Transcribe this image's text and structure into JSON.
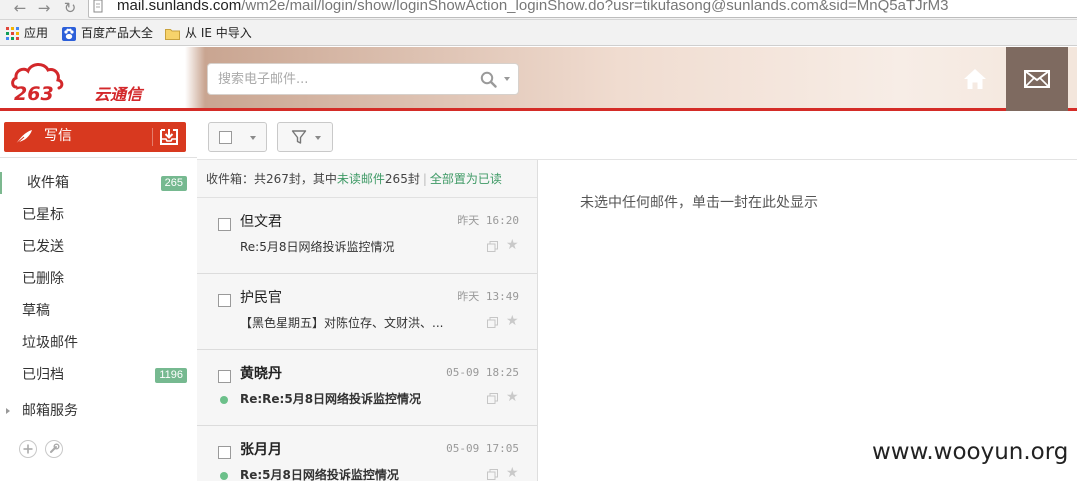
{
  "browser": {
    "url_host": "mail.sunlands.com",
    "url_rest": "/wm2e/mail/login/show/loginShowAction_loginShow.do?usr=tikufasong@sunlands.com&sid=MnQ5aTJrM3",
    "bookmarks": [
      "应用",
      "百度产品大全",
      "从 IE 中导入"
    ]
  },
  "header": {
    "logo_text": "263云通信",
    "search_placeholder": "搜索电子邮件..."
  },
  "sidebar": {
    "compose_label": "写信",
    "folders": [
      {
        "label": "收件箱",
        "count": "265"
      },
      {
        "label": "已星标",
        "count": ""
      },
      {
        "label": "已发送",
        "count": ""
      },
      {
        "label": "已删除",
        "count": ""
      },
      {
        "label": "草稿",
        "count": ""
      },
      {
        "label": "垃圾邮件",
        "count": ""
      },
      {
        "label": "已归档",
        "count": "1196"
      }
    ],
    "service_label": "邮箱服务"
  },
  "list": {
    "summary_prefix": "收件箱：共267封，其中",
    "unread_link": "未读邮件",
    "summary_suffix": "265封",
    "mark_all_read": "全部置为已读",
    "items": [
      {
        "sender": "但文君",
        "time": "昨天 16:20",
        "subject": "Re:5月8日网络投诉监控情况"
      },
      {
        "sender": "护民官",
        "time": "昨天 13:49",
        "subject": "【黑色星期五】对陈位存、文财洪、..."
      },
      {
        "sender": "黄晓丹",
        "time": "05-09 18:25",
        "subject": "Re:Re:5月8日网络投诉监控情况"
      },
      {
        "sender": "张月月",
        "time": "05-09 17:05",
        "subject": "Re:5月8日网络投诉监控情况"
      }
    ]
  },
  "reading_pane": {
    "hint": "未选中任何邮件，单击一封在此处显示"
  },
  "watermark": "www.wooyun.org",
  "colors": {
    "brand_red": "#d42c27",
    "compose_red": "#d8391f",
    "accent_green": "#76b990"
  }
}
